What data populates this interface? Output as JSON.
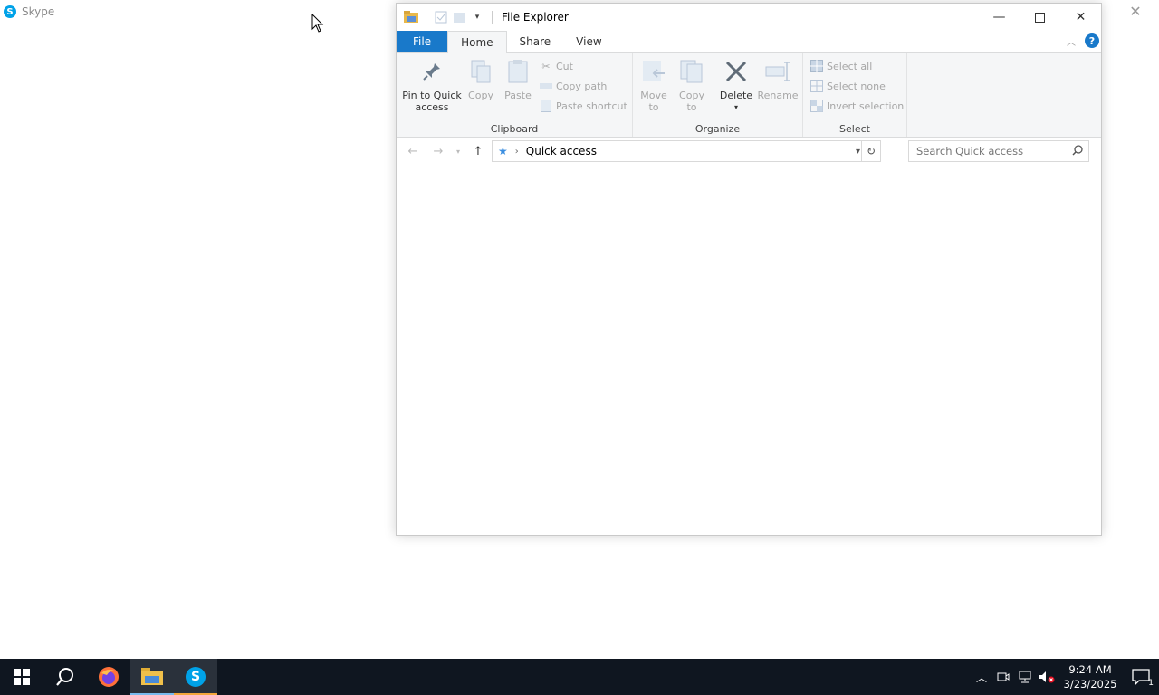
{
  "skype": {
    "title": "Skype",
    "logo_letter": "S"
  },
  "explorer": {
    "title": "File Explorer",
    "tabs": [
      {
        "label": "File"
      },
      {
        "label": "Home"
      },
      {
        "label": "Share"
      },
      {
        "label": "View"
      }
    ],
    "ribbon": {
      "clipboard": {
        "label": "Clipboard",
        "pin_line1": "Pin to Quick",
        "pin_line2": "access",
        "copy": "Copy",
        "paste": "Paste",
        "cut": "Cut",
        "copy_path": "Copy path",
        "paste_shortcut": "Paste shortcut"
      },
      "organize": {
        "label": "Organize",
        "move_to_line1": "Move",
        "move_to_line2": "to",
        "copy_to_line1": "Copy",
        "copy_to_line2": "to",
        "delete": "Delete",
        "rename": "Rename"
      },
      "select": {
        "label": "Select",
        "select_all": "Select all",
        "select_none": "Select none",
        "invert_selection": "Invert selection"
      }
    },
    "address": {
      "path": "Quick access"
    },
    "search": {
      "placeholder": "Search Quick access"
    }
  },
  "taskbar": {
    "clock_time": "9:24 AM",
    "clock_date": "3/23/2025",
    "notification_count": "1",
    "skype_letter": "S"
  },
  "colors": {
    "accent": "#1979ca",
    "taskbar_bg": "#0f1620",
    "skype_blue": "#00a2e8"
  }
}
